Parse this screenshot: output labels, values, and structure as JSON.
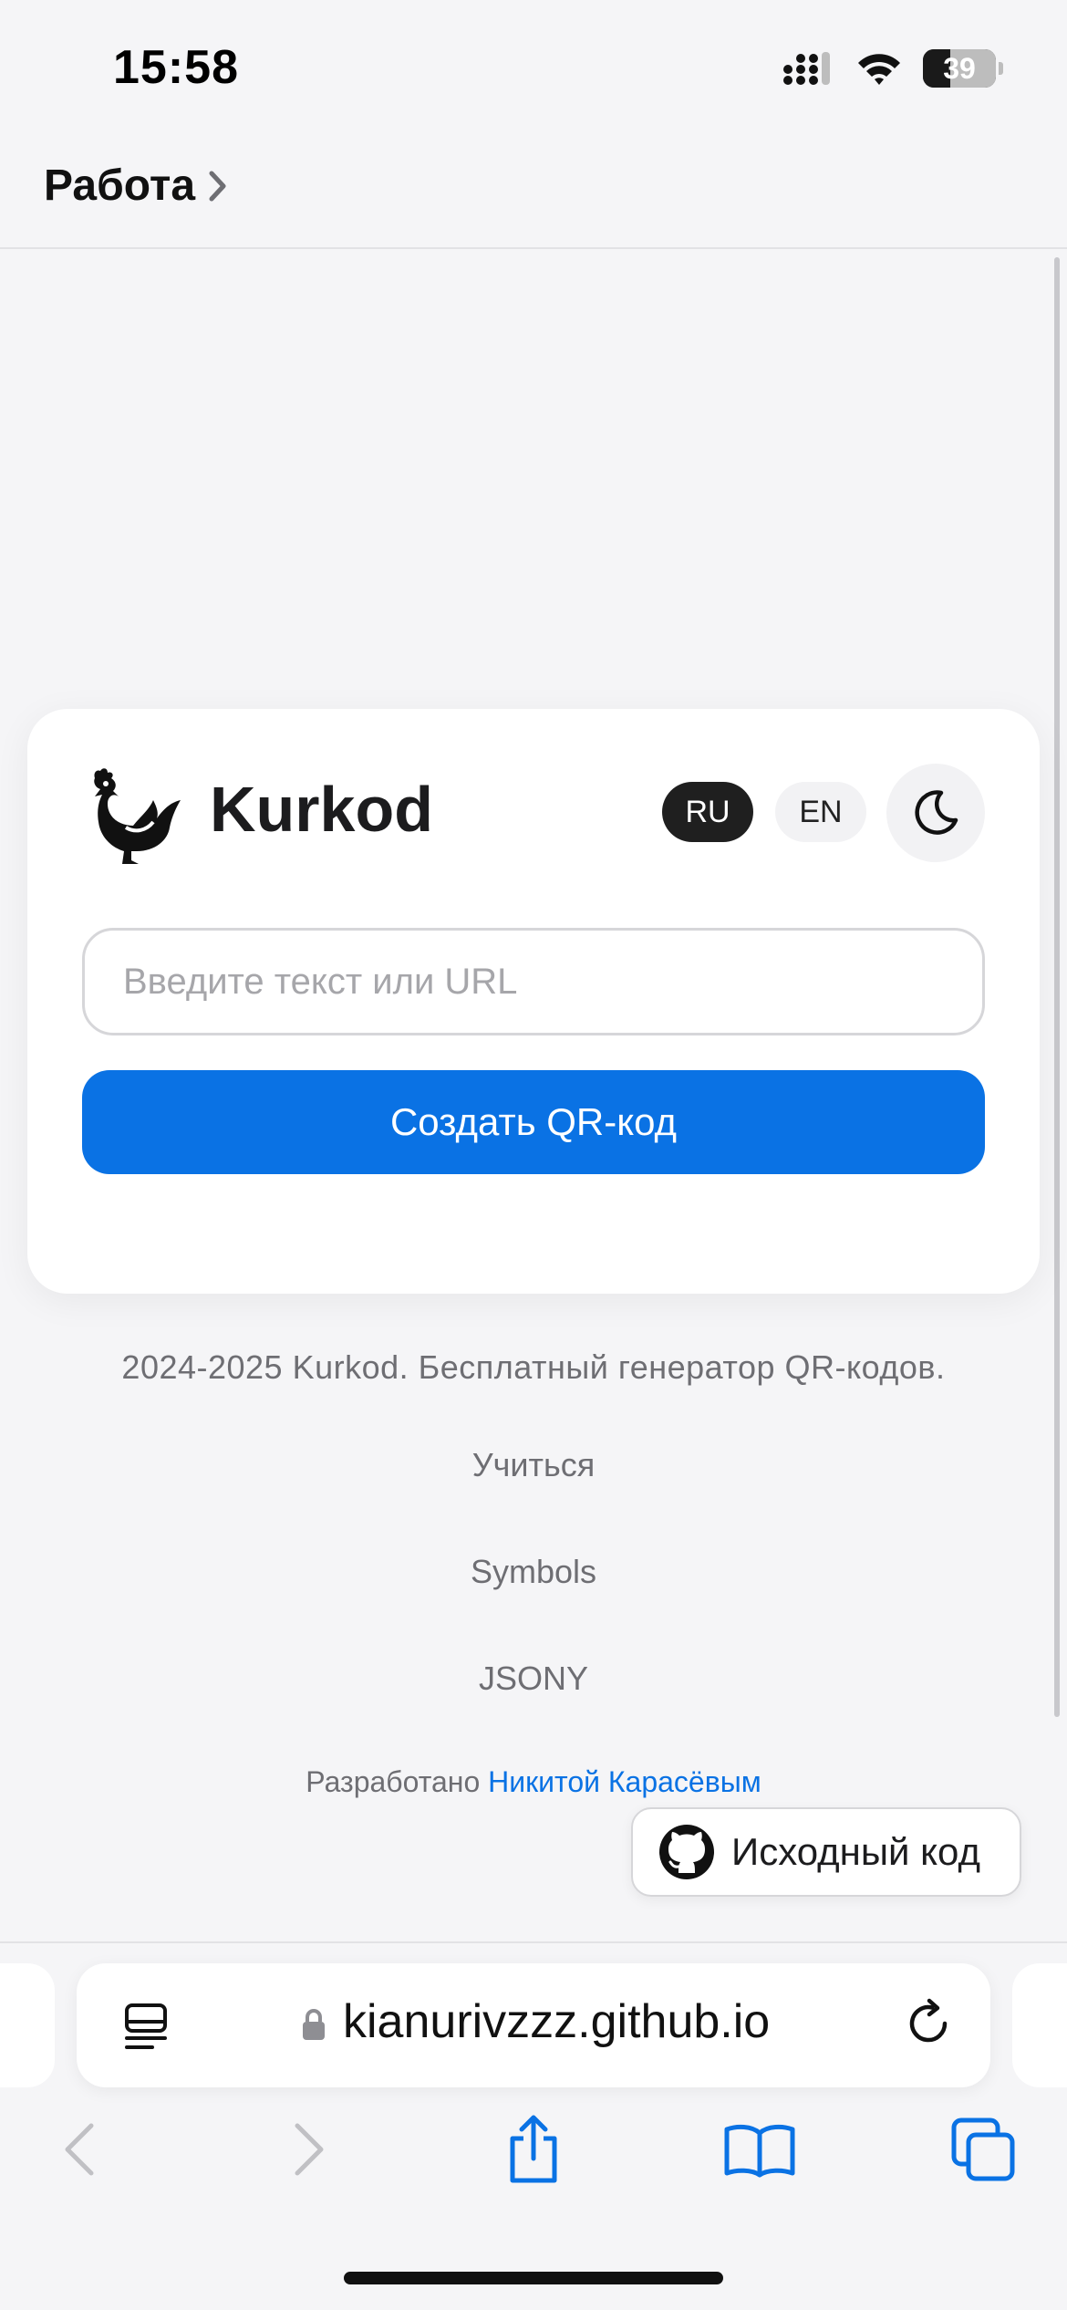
{
  "status_bar": {
    "time": "15:58",
    "battery_level": "39"
  },
  "back_nav": {
    "label": "Работа"
  },
  "card": {
    "brand": "Kurkod",
    "lang_ru": "RU",
    "lang_en": "EN",
    "input_placeholder": "Введите текст или URL",
    "input_value": "",
    "create_button": "Создать QR-код"
  },
  "footer": {
    "copyright": "2024-2025 Kurkod. Бесплатный генератор QR-кодов.",
    "links": [
      "Учиться",
      "Symbols",
      "JSONY"
    ],
    "credit_prefix": "Разработано",
    "credit_author": "Никитой Карасёвым",
    "source_button": "Исходный код"
  },
  "safari": {
    "url": "kianurivzzz.github.io"
  },
  "colors": {
    "accent": "#0a72e4",
    "active_lang": "#1f1f1f",
    "background": "#f5f5f7"
  },
  "icons": [
    "signal-icon",
    "wifi-icon",
    "battery-icon",
    "chevron-right-icon",
    "rooster-logo-icon",
    "moon-icon",
    "github-icon",
    "reader-icon",
    "lock-icon",
    "reload-icon",
    "back-icon",
    "forward-icon",
    "share-icon",
    "bookmarks-icon",
    "tabs-icon"
  ]
}
